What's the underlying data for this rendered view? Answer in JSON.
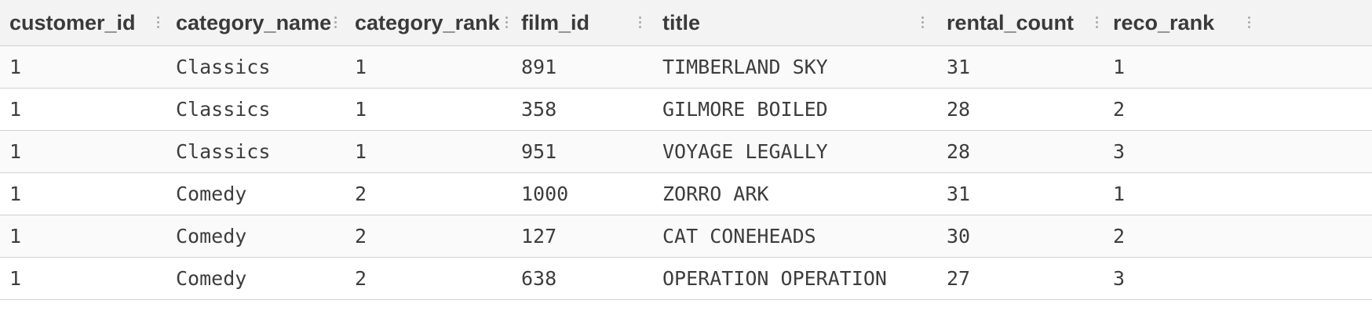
{
  "table": {
    "columns": [
      {
        "label": "customer_id"
      },
      {
        "label": "category_name"
      },
      {
        "label": "category_rank"
      },
      {
        "label": "film_id"
      },
      {
        "label": "title"
      },
      {
        "label": "rental_count"
      },
      {
        "label": "reco_rank"
      }
    ],
    "rows": [
      {
        "customer_id": "1",
        "category_name": "Classics",
        "category_rank": "1",
        "film_id": "891",
        "title": "TIMBERLAND SKY",
        "rental_count": "31",
        "reco_rank": "1"
      },
      {
        "customer_id": "1",
        "category_name": "Classics",
        "category_rank": "1",
        "film_id": "358",
        "title": "GILMORE BOILED",
        "rental_count": "28",
        "reco_rank": "2"
      },
      {
        "customer_id": "1",
        "category_name": "Classics",
        "category_rank": "1",
        "film_id": "951",
        "title": "VOYAGE LEGALLY",
        "rental_count": "28",
        "reco_rank": "3"
      },
      {
        "customer_id": "1",
        "category_name": "Comedy",
        "category_rank": "2",
        "film_id": "1000",
        "title": "ZORRO ARK",
        "rental_count": "31",
        "reco_rank": "1"
      },
      {
        "customer_id": "1",
        "category_name": "Comedy",
        "category_rank": "2",
        "film_id": "127",
        "title": "CAT CONEHEADS",
        "rental_count": "30",
        "reco_rank": "2"
      },
      {
        "customer_id": "1",
        "category_name": "Comedy",
        "category_rank": "2",
        "film_id": "638",
        "title": "OPERATION OPERATION",
        "rental_count": "27",
        "reco_rank": "3"
      }
    ]
  }
}
